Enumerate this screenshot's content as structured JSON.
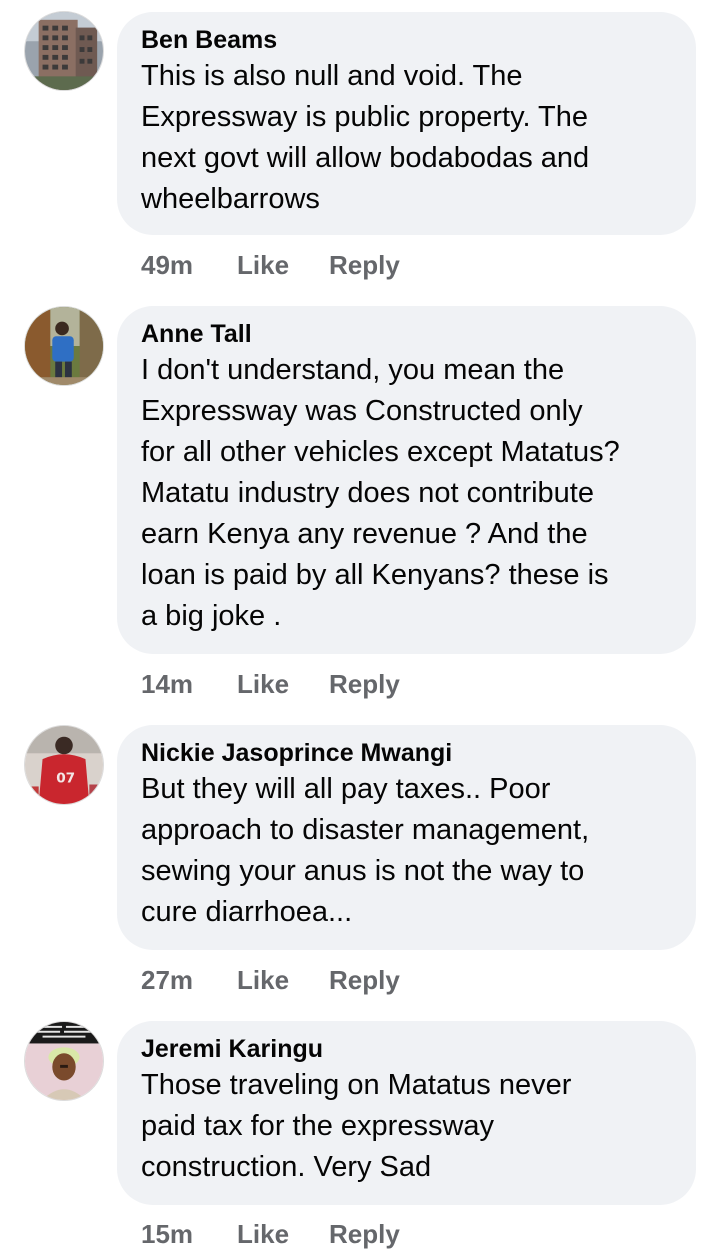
{
  "comments": [
    {
      "author": "Ben Beams",
      "avatar_icon": "building-photo-avatar",
      "text": "This is also null and void. The\nExpressway is public property. The\nnext govt will allow bodabodas and\nwheelbarrows",
      "time": "49m",
      "like_label": "Like",
      "reply_label": "Reply"
    },
    {
      "author": "Anne Tall",
      "avatar_icon": "person-photo-avatar",
      "text": "I don't understand, you mean the\nExpressway was Constructed only\nfor all other vehicles except Matatus?\nMatatu industry does not contribute\nearn Kenya any revenue ? And the\nloan is paid by all Kenyans?  these is\na big joke .",
      "time": "14m",
      "like_label": "Like",
      "reply_label": "Reply"
    },
    {
      "author": "Nickie Jasoprince Mwangi",
      "avatar_icon": "jersey-photo-avatar",
      "text": "But they will all pay taxes.. Poor\napproach to disaster management,\nsewing your anus is not the way to\ncure diarrhoea...",
      "time": "27m",
      "like_label": "Like",
      "reply_label": "Reply"
    },
    {
      "author": "Jeremi Karingu",
      "avatar_icon": "woman-photo-avatar",
      "text": "Those traveling on Matatus never\npaid tax for the expressway\nconstruction. Very Sad",
      "time": "15m",
      "like_label": "Like",
      "reply_label": "Reply"
    }
  ]
}
